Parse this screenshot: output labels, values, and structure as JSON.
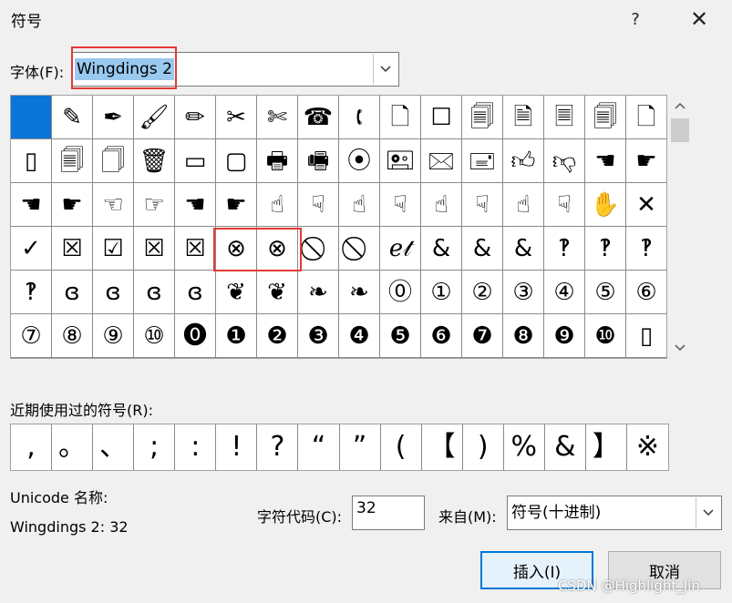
{
  "window": {
    "title": "符号",
    "help_label": "?",
    "close_label": "✕"
  },
  "font": {
    "label": "字体(F):",
    "value": "Wingdings 2"
  },
  "symbol_grid": {
    "rows": [
      [
        "",
        "✎",
        "✒",
        "🖌",
        "✏",
        "✂",
        "✄",
        "☎",
        "🕻",
        "🗋",
        "☐",
        "🗐",
        "🗎",
        "🗏",
        "🗐",
        "🗋"
      ],
      [
        "▯",
        "🗐",
        "🗍",
        "🗑",
        "▭",
        "▢",
        "🖶",
        "🖷",
        "⦿",
        "🖭",
        "🖂",
        "🖃",
        "👍︎",
        "👎︎",
        "☚",
        "☛"
      ],
      [
        "☚",
        "☛",
        "☜",
        "☞",
        "☚",
        "☛",
        "☝",
        "☟",
        "☝",
        "☟",
        "☝",
        "☟",
        "☝",
        "☟",
        "✋",
        "✕"
      ],
      [
        "✓",
        "☒",
        "☑",
        "☒",
        "☒",
        "⊗",
        "⊗",
        "⃠",
        "⃠",
        "ℯ𝓉",
        "&",
        "&",
        "&",
        "‽",
        "‽",
        "‽"
      ],
      [
        "‽",
        "ɞ",
        "ɞ",
        "ɞ",
        "ɞ",
        "❦",
        "❦",
        "❧",
        "❧",
        "⓪",
        "①",
        "②",
        "③",
        "④",
        "⑤",
        "⑥"
      ],
      [
        "⑦",
        "⑧",
        "⑨",
        "⑩",
        "⓿",
        "❶",
        "❷",
        "❸",
        "❹",
        "❺",
        "❻",
        "❼",
        "❽",
        "❾",
        "❿",
        "▯"
      ]
    ]
  },
  "recent": {
    "label": "近期使用过的符号(R):",
    "symbols": [
      ",",
      "。",
      "、",
      ";",
      ":",
      "!",
      "?",
      "“",
      "”",
      "(",
      "【",
      ")",
      "%",
      "&",
      "】",
      "※"
    ]
  },
  "unicode": {
    "label": "Unicode 名称:",
    "value": "Wingdings 2: 32"
  },
  "char_code": {
    "label": "字符代码(C):",
    "value": "32"
  },
  "from": {
    "label": "来自(M):",
    "value": "符号(十进制)"
  },
  "buttons": {
    "insert": "插入(I)",
    "cancel": "取消"
  },
  "watermark": "CSDN @Highlight_Jin"
}
